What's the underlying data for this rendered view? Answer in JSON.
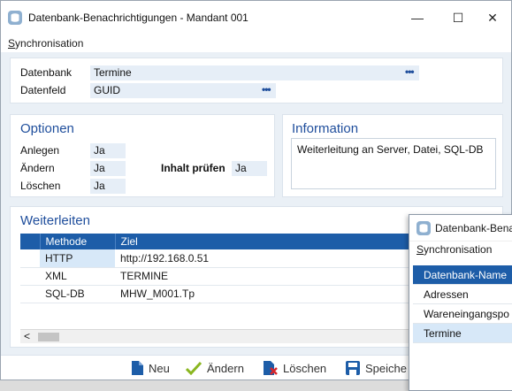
{
  "window": {
    "title": "Datenbank-Benachrichtigungen - Mandant 001",
    "controls": {
      "minimize": "—",
      "maximize": "☐",
      "close": "✕"
    }
  },
  "menu": {
    "sync_first": "S",
    "sync_rest": "ynchronisation"
  },
  "top": {
    "datenbank_label": "Datenbank",
    "datenbank_value": "Termine",
    "datenfeld_label": "Datenfeld",
    "datenfeld_value": "GUID",
    "dots": "•••"
  },
  "optionen": {
    "title": "Optionen",
    "anlegen_label": "Anlegen",
    "anlegen_value": "Ja",
    "aendern_label": "Ändern",
    "aendern_value": "Ja",
    "loeschen_label": "Löschen",
    "loeschen_value": "Ja",
    "inhalt_label": "Inhalt prüfen",
    "inhalt_value": "Ja"
  },
  "information": {
    "title": "Information",
    "text": "Weiterleitung an Server, Datei, SQL-DB"
  },
  "weiterleiten": {
    "title": "Weiterleiten",
    "columns": [
      "Methode",
      "Ziel"
    ],
    "rows": [
      [
        "HTTP",
        "http://192.168.0.51"
      ],
      [
        "XML",
        "TERMINE"
      ],
      [
        "SQL-DB",
        "MHW_M001.Tp"
      ]
    ],
    "scroll_left": "<"
  },
  "toolbar": {
    "neu": "Neu",
    "aendern": "Ändern",
    "loeschen": "Löschen",
    "speichern": "Speiche"
  },
  "popup": {
    "title": "Datenbank-Bena",
    "menu_first": "S",
    "menu_rest": "ynchronisation",
    "header": "Datenbank-Name",
    "items": [
      "Adressen",
      "Wareneingangspo",
      "Termine"
    ]
  },
  "colors": {
    "accent": "#1d5da8",
    "title_blue": "#1f4e9c",
    "field_bg": "#e6eef7",
    "selection": "#d7e8f8"
  }
}
